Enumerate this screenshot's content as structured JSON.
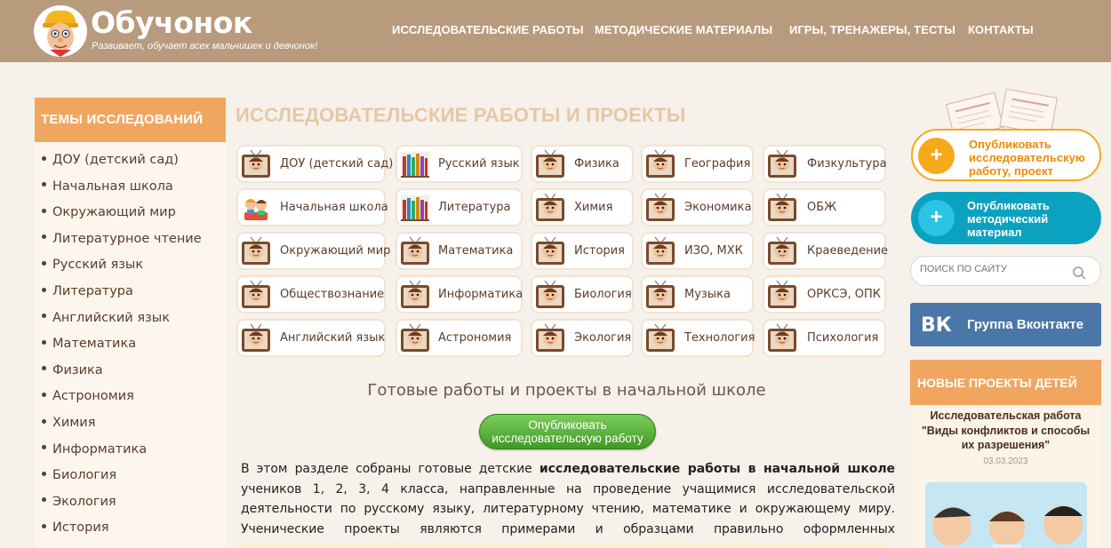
{
  "header": {
    "logo_title": "Обучонок",
    "logo_slogan": "Развивает, обучает всех мальчишек и девчонок!",
    "nav": [
      {
        "label": "ИССЛЕДОВАТЕЛЬСКИЕ РАБОТЫ"
      },
      {
        "label": "МЕТОДИЧЕСКИЕ МАТЕРИАЛЫ"
      },
      {
        "label": "ИГРЫ, ТРЕНАЖЕРЫ, ТЕСТЫ"
      },
      {
        "label": "КОНТАКТЫ"
      }
    ]
  },
  "sidebar": {
    "title": "ТЕМЫ ИССЛЕДОВАНИЙ",
    "items": [
      {
        "label": "ДОУ (детский сад)"
      },
      {
        "label": "Начальная школа"
      },
      {
        "label": "Окружающий мир"
      },
      {
        "label": "Литературное чтение"
      },
      {
        "label": "Русский язык"
      },
      {
        "label": "Литература"
      },
      {
        "label": "Английский язык"
      },
      {
        "label": "Математика"
      },
      {
        "label": "Физика"
      },
      {
        "label": "Астрономия"
      },
      {
        "label": "Химия"
      },
      {
        "label": "Информатика"
      },
      {
        "label": "Биология"
      },
      {
        "label": "Экология"
      },
      {
        "label": "История"
      }
    ]
  },
  "main": {
    "title": "ИССЛЕДОВАТЕЛЬСКИЕ РАБОТЫ И ПРОЕКТЫ",
    "subjects": [
      {
        "label": "ДОУ (детский сад)",
        "icon": "boy-tv-icon"
      },
      {
        "label": "Русский язык",
        "icon": "books-icon"
      },
      {
        "label": "Физика",
        "icon": "boy-tv-icon"
      },
      {
        "label": "География",
        "icon": "boy-tv-icon"
      },
      {
        "label": "Физкультура",
        "icon": "boy-tv-icon"
      },
      {
        "label": "Начальная школа",
        "icon": "kids-icon"
      },
      {
        "label": "Литература",
        "icon": "books-icon"
      },
      {
        "label": "Химия",
        "icon": "boy-tv-icon"
      },
      {
        "label": "Экономика",
        "icon": "boy-tv-icon"
      },
      {
        "label": "ОБЖ",
        "icon": "boy-tv-icon"
      },
      {
        "label": "Окружающий мир",
        "icon": "boy-tv-icon"
      },
      {
        "label": "Математика",
        "icon": "boy-tv-icon"
      },
      {
        "label": "История",
        "icon": "boy-tv-icon"
      },
      {
        "label": "ИЗО, МХК",
        "icon": "boy-tv-icon"
      },
      {
        "label": "Краеведение",
        "icon": "boy-tv-icon"
      },
      {
        "label": "Обществознание",
        "icon": "boy-tv-icon"
      },
      {
        "label": "Информатика",
        "icon": "boy-tv-icon"
      },
      {
        "label": "Биология",
        "icon": "boy-tv-icon"
      },
      {
        "label": "Музыка",
        "icon": "boy-tv-icon"
      },
      {
        "label": "ОРКСЭ, ОПК",
        "icon": "boy-tv-icon"
      },
      {
        "label": "Английский язык",
        "icon": "boy-tv-icon"
      },
      {
        "label": "Астрономия",
        "icon": "boy-tv-icon"
      },
      {
        "label": "Экология",
        "icon": "boy-tv-icon"
      },
      {
        "label": "Технология",
        "icon": "boy-tv-icon"
      },
      {
        "label": "Психология",
        "icon": "boy-tv-icon"
      }
    ],
    "section_title": "Готовые работы и проекты в начальной школе",
    "publish_button_line1": "Опубликовать",
    "publish_button_line2": "исследовательскую работу",
    "intro_part1": "В этом разделе собраны готовые детские ",
    "intro_bold": "исследовательские работы в начальной школе",
    "intro_part2": " учеников 1, 2, 3, 4 класса, направленные на проведение учащимися исследовательской деятельности по русскому языку, литературному чтению, математике и окружающему миру. Ученические проекты являются примерами и образцами правильно оформленных исследовательских работ."
  },
  "right": {
    "publish_research": {
      "line1": "Опубликовать",
      "line2": "исследовательскую",
      "line3": "работу, проект",
      "color": "#f5a91b"
    },
    "publish_method": {
      "line1": "Опубликовать",
      "line2": "методический",
      "line3": "материал",
      "color": "#0aa2c0"
    },
    "search_placeholder": "ПОИСК ПО САЙТУ",
    "vk_logo": "ВК",
    "vk_label": "Группа Вконтакте",
    "new_projects_title": "НОВЫЕ ПРОЕКТЫ ДЕТЕЙ",
    "new_project": {
      "line1": "Исследовательская работа",
      "line2": "\"Виды конфликтов и способы",
      "line3": "их разрешения\"",
      "date": "03.03.2023"
    }
  },
  "colors": {
    "header": "#b89a7d",
    "accent_orange": "#f1a660",
    "green": "#4fa92f",
    "vk": "#4a76a8"
  }
}
